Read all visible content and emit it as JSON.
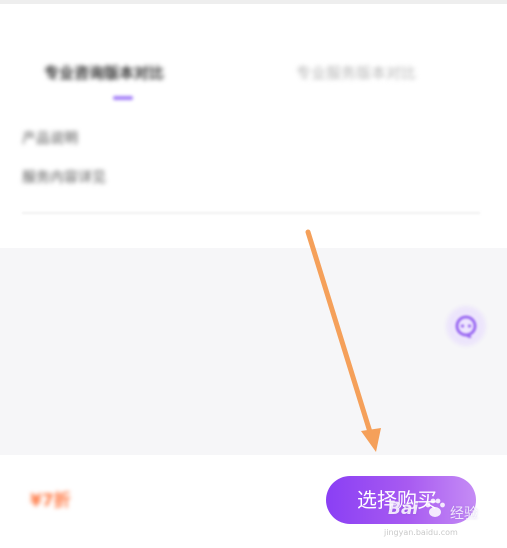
{
  "tabs": [
    {
      "label": "专业咨询版本对比",
      "active": true
    },
    {
      "label": "专业服务版本对比",
      "active": false
    }
  ],
  "info": {
    "line1": "产品说明",
    "line2": "服务内容详见"
  },
  "bottom_bar": {
    "price": "¥7折",
    "buy_label": "选择购买"
  },
  "floating": {
    "icon": "customer-service-icon"
  },
  "watermark": {
    "brand": "Bai",
    "brand_sub": "经验",
    "url": "jingyan.baidu.com"
  },
  "colors": {
    "accent": "#8b5cf6",
    "button_start": "#8a3ff4",
    "button_end": "#c58cf5",
    "price": "#ff7a45",
    "arrow": "#f5a05a"
  }
}
